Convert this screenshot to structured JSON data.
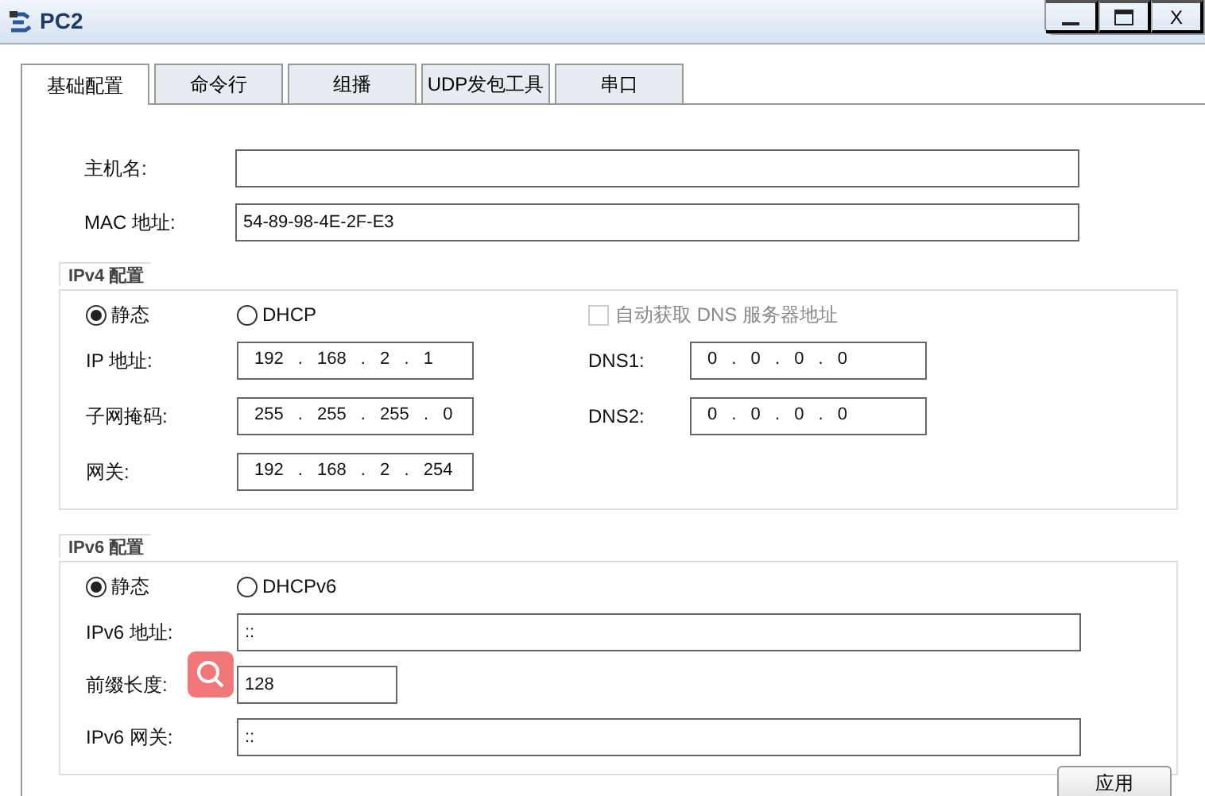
{
  "window": {
    "title": "PC2",
    "close": "X"
  },
  "tabs": [
    {
      "label": "基础配置",
      "selected": true
    },
    {
      "label": "命令行",
      "selected": false
    },
    {
      "label": "组播",
      "selected": false
    },
    {
      "label": "UDP发包工具",
      "selected": false
    },
    {
      "label": "串口",
      "selected": false
    }
  ],
  "host": [
    {
      "label": "主机名:"
    },
    {
      "label": "MAC 地址:",
      "value": "54-89-98-4E-2F-E3"
    }
  ],
  "ipv4": {
    "title": "IPv4 配置",
    "modes": [
      {
        "label": "静态",
        "selected": true
      },
      {
        "label": "DHCP",
        "selected": false
      }
    ],
    "dns_auto": {
      "label": "自动获取 DNS 服务器地址",
      "checked": false,
      "disabled": true
    },
    "rows": [
      {
        "label": "IP 地址:",
        "value": "192 . 168 . 2 . 1",
        "dns_label": "DNS1:",
        "dns_value": "0 . 0 . 0 . 0"
      },
      {
        "label": "子网掩码:",
        "value": "255 . 255 . 255 . 0",
        "dns_label": "DNS2:",
        "dns_value": "0 . 0 . 0 . 0"
      },
      {
        "label": "网关:",
        "value": "192 . 168 . 2 . 254"
      }
    ]
  },
  "ipv6": {
    "title": "IPv6 配置",
    "modes": [
      {
        "label": "静态",
        "selected": true
      },
      {
        "label": "DHCPv6",
        "selected": false
      }
    ],
    "rows": [
      {
        "label": "IPv6 地址:",
        "value": "::",
        "kind": "wide"
      },
      {
        "label": "前缀长度:",
        "value": "128",
        "kind": "short"
      },
      {
        "label": "IPv6 网关:",
        "value": "::",
        "kind": "wide"
      }
    ]
  },
  "apply": "应用"
}
